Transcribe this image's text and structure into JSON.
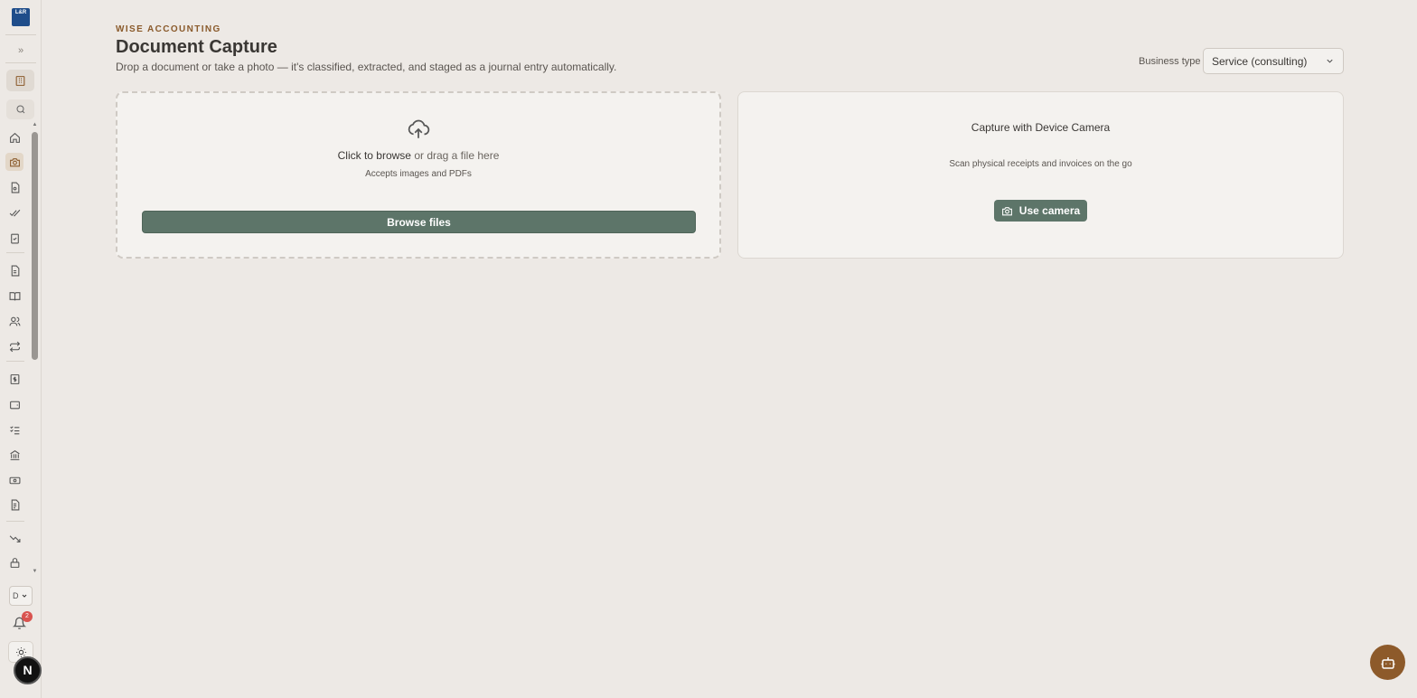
{
  "sidebar": {
    "logo_text": "L&R",
    "expand_icon": "chevrons-right-icon",
    "brand_icon": "building-icon",
    "search_icon": "search-icon",
    "nav_items": [
      {
        "icon": "home-icon",
        "active": false
      },
      {
        "icon": "camera-icon",
        "active": true
      },
      {
        "icon": "document-search-icon",
        "active": false
      },
      {
        "icon": "double-check-icon",
        "active": false
      },
      {
        "icon": "clipboard-check-icon",
        "active": false
      },
      {
        "icon": "file-text-icon",
        "active": false
      },
      {
        "icon": "book-open-icon",
        "active": false
      },
      {
        "icon": "users-icon",
        "active": false
      },
      {
        "icon": "repeat-icon",
        "active": false
      },
      {
        "icon": "receipt-dollar-icon",
        "active": false
      },
      {
        "icon": "wallet-icon",
        "active": false
      },
      {
        "icon": "list-checks-icon",
        "active": false
      },
      {
        "icon": "bank-icon",
        "active": false
      },
      {
        "icon": "banknote-icon",
        "active": false
      },
      {
        "icon": "file-lines-icon",
        "active": false
      },
      {
        "icon": "trending-down-icon",
        "active": false
      },
      {
        "icon": "lock-icon",
        "active": false
      }
    ],
    "org_select_value": "D",
    "notification_count": "2",
    "user_initial": "N"
  },
  "header": {
    "eyebrow": "WISE ACCOUNTING",
    "title": "Document Capture",
    "subtitle": "Drop a document or take a photo — it's classified, extracted, and staged as a journal entry automatically.",
    "business_type_label": "Business type",
    "business_type_value": "Service (consulting)"
  },
  "dropzone": {
    "browse_link": "Click to browse",
    "browse_rest": "or drag a file here",
    "accepts": "Accepts images and PDFs",
    "button_label": "Browse files"
  },
  "camera": {
    "title": "Capture with Device Camera",
    "subtitle": "Scan physical receipts and invoices on the go",
    "button_label": "Use camera"
  },
  "colors": {
    "background": "#ede9e5",
    "accent_green": "#5d7569",
    "eyebrow_brown": "#8a5a2b",
    "assistant_brown": "#8d5a2a",
    "badge_red": "#d9534f"
  }
}
